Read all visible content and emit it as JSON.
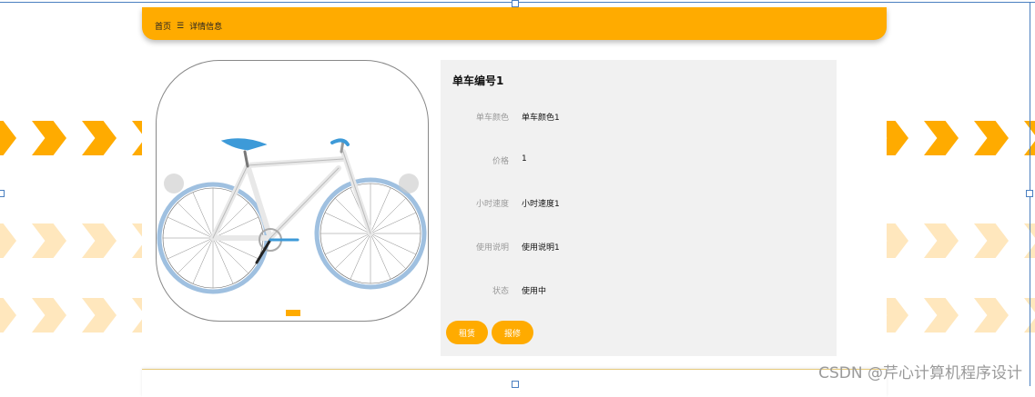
{
  "breadcrumb": {
    "home": "首页",
    "separator": "☰",
    "current": "详情信息"
  },
  "detail": {
    "title": "单车编号1",
    "fields": [
      {
        "label": "单车颜色",
        "value": "单车颜色1"
      },
      {
        "label": "价格",
        "value": "1"
      },
      {
        "label": "小时速度",
        "value": "小时速度1"
      },
      {
        "label": "使用说明",
        "value": "使用说明1"
      },
      {
        "label": "状态",
        "value": "使用中"
      }
    ],
    "buttons": {
      "rent": "租赁",
      "report": "报修"
    }
  },
  "image": {
    "subject": "bicycle"
  },
  "watermark": "CSDN @芹心计算机程序设计",
  "colors": {
    "accent": "#ffab00",
    "panel": "#f1f1f1",
    "label": "#999999"
  }
}
